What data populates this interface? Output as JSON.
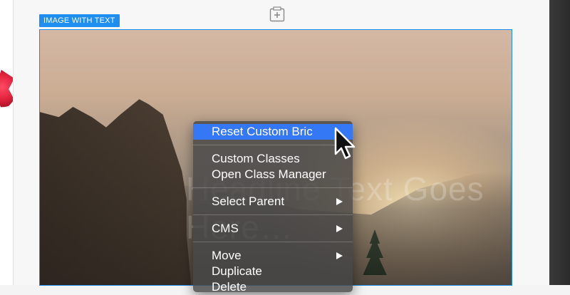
{
  "block": {
    "label": "IMAGE WITH TEXT",
    "ghost_text": "Headline Text Goes Here…"
  },
  "toolbar": {
    "add_icon": "add-block-icon"
  },
  "context_menu": {
    "groups": [
      {
        "items": [
          {
            "label": "Reset Custom Bric",
            "highlighted": true
          }
        ]
      },
      {
        "items": [
          {
            "label": "Custom Classes"
          },
          {
            "label": "Open Class Manager"
          }
        ]
      },
      {
        "items": [
          {
            "label": "Select Parent",
            "submenu": true
          }
        ]
      },
      {
        "items": [
          {
            "label": "CMS",
            "submenu": true
          }
        ]
      },
      {
        "items": [
          {
            "label": "Move",
            "submenu": true
          },
          {
            "label": "Duplicate"
          },
          {
            "label": "Delete"
          }
        ]
      }
    ]
  },
  "colors": {
    "accent": "#1e8ef0",
    "menu_highlight": "#3478f6"
  }
}
